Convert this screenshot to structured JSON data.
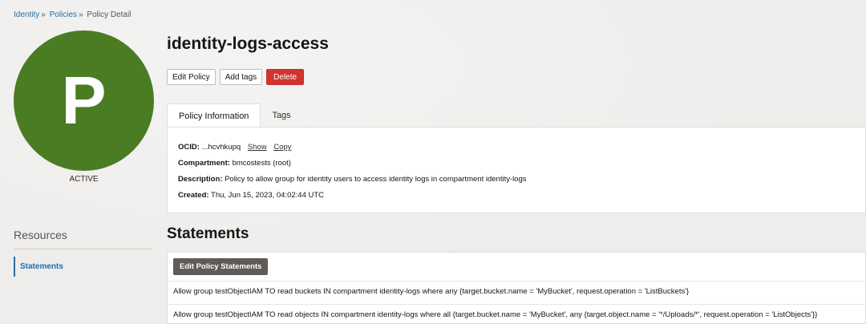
{
  "breadcrumb": {
    "items": [
      "Identity",
      "Policies",
      "Policy Detail"
    ],
    "separator": "»"
  },
  "avatar": {
    "letter": "P",
    "color": "#4a7c23"
  },
  "status": "ACTIVE",
  "title": "identity-logs-access",
  "actions": {
    "edit": "Edit Policy",
    "tags": "Add tags",
    "delete": "Delete"
  },
  "tabs": [
    "Policy Information",
    "Tags"
  ],
  "info": {
    "ocid_label": "OCID:",
    "ocid_value": "...hcvhkupq",
    "show": "Show",
    "copy": "Copy",
    "compartment_label": "Compartment:",
    "compartment_value": "bmcostests (root)",
    "description_label": "Description:",
    "description_value": "Policy to allow group for identity users to access identity logs in compartment identity-logs",
    "created_label": "Created:",
    "created_value": "Thu, Jun 15, 2023, 04:02:44 UTC"
  },
  "resources": {
    "title": "Resources",
    "items": [
      "Statements"
    ]
  },
  "statements": {
    "title": "Statements",
    "edit_button": "Edit Policy Statements",
    "rows": [
      "Allow group testObjectIAM TO read buckets IN compartment identity-logs where any {target.bucket.name = 'MyBucket', request.operation = 'ListBuckets'}",
      "Allow group testObjectIAM TO read objects IN compartment identity-logs where all {target.bucket.name = 'MyBucket', any {target.object.name = '*/Uploads/*', request.operation = 'ListObjects'}}"
    ]
  },
  "colors": {
    "link": "#1f6faa",
    "danger": "#d1342f",
    "dark_button": "#5f5b56"
  }
}
